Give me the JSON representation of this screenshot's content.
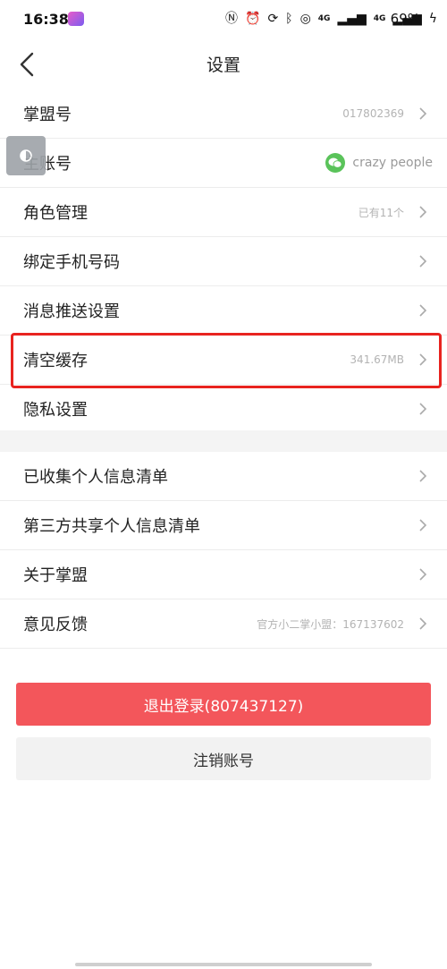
{
  "status_bar": {
    "time": "16:38",
    "battery": "69%",
    "network_a": "4G",
    "network_b": "4G"
  },
  "header": {
    "title": "设置"
  },
  "section_one": [
    {
      "label": "掌盟号",
      "value": "017802369"
    },
    {
      "label": "主账号",
      "value": "crazy people"
    },
    {
      "label": "角色管理",
      "value": "已有11个"
    },
    {
      "label": "绑定手机号码",
      "value": ""
    },
    {
      "label": "消息推送设置",
      "value": ""
    },
    {
      "label": "清空缓存",
      "value": "341.67MB"
    },
    {
      "label": "隐私设置",
      "value": ""
    }
  ],
  "section_two": [
    {
      "label": "已收集个人信息清单",
      "value": ""
    },
    {
      "label": "第三方共享个人信息清单",
      "value": ""
    },
    {
      "label": "关于掌盟",
      "value": ""
    },
    {
      "label": "意见反馈",
      "value": "官方小二掌小盟：167137602"
    }
  ],
  "buttons": {
    "logout": "退出登录(807437127)",
    "cancel_account": "注销账号"
  },
  "colors": {
    "logout_bg": "#f3565b",
    "highlight": "#e8231f",
    "wechat_green": "#5ac35a"
  }
}
